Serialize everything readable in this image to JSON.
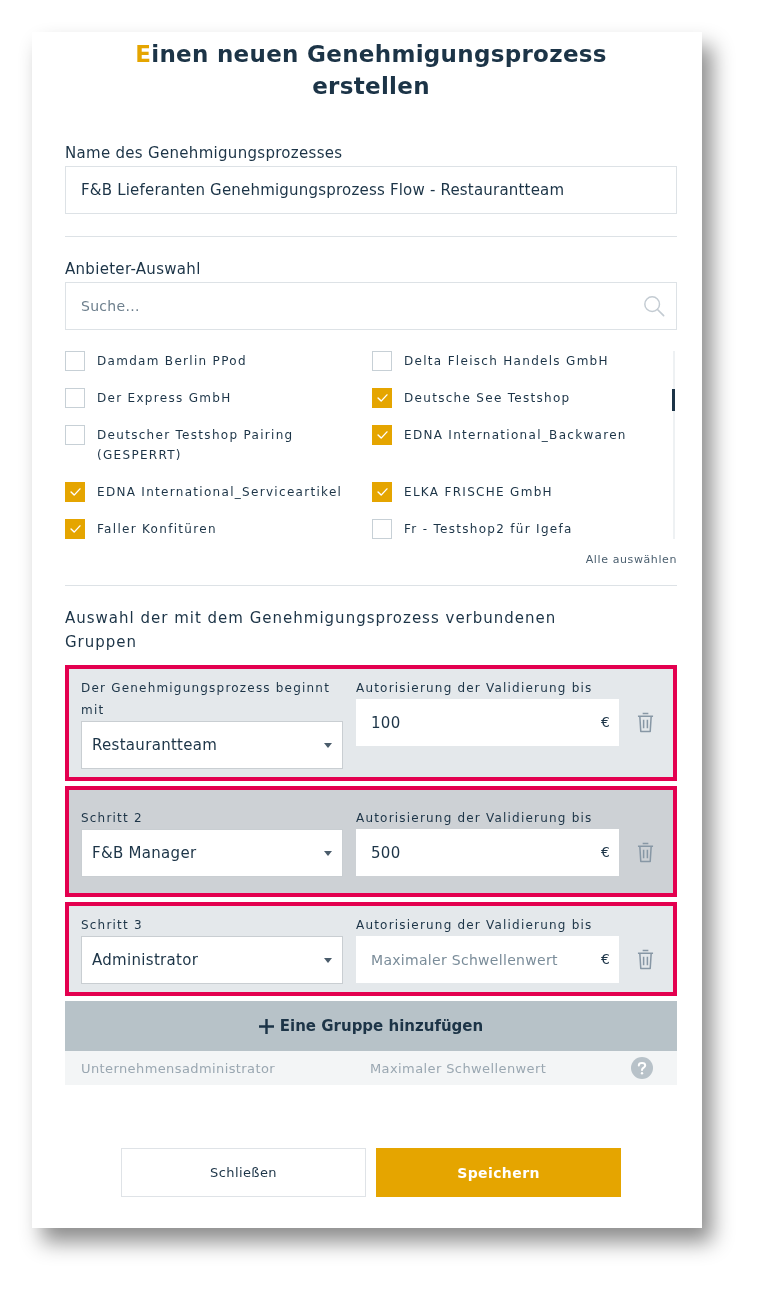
{
  "dialog": {
    "title": "Einen neuen Genehmigungsprozess erstellen"
  },
  "name_field": {
    "label": "Name des Genehmigungsprozesses",
    "value": "F&B Lieferanten Genehmigungsprozess Flow - Restaurantteam"
  },
  "vendor_selection": {
    "label": "Anbieter-Auswahl",
    "search": {
      "placeholder": "Suche..."
    },
    "vendors": [
      {
        "name": "Damdam Berlin PPod",
        "checked": false
      },
      {
        "name": "Delta Fleisch Handels GmbH",
        "checked": false
      },
      {
        "name": "Der Express GmbH",
        "checked": false
      },
      {
        "name": "Deutsche See Testshop",
        "checked": true
      },
      {
        "name": "Deutscher Testshop Pairing (GESPERRT)",
        "checked": false
      },
      {
        "name": "EDNA International_Backwaren",
        "checked": true
      },
      {
        "name": "EDNA International_Serviceartikel",
        "checked": true
      },
      {
        "name": "ELKA FRISCHE GmbH",
        "checked": true
      },
      {
        "name": "Faller Konfitüren",
        "checked": true
      },
      {
        "name": "Fr - Testshop2 für Igefa",
        "checked": false
      }
    ],
    "select_all": "Alle auswählen"
  },
  "groups": {
    "heading": "Auswahl der mit dem Genehmigungsprozess verbundenen Gruppen",
    "steps": [
      {
        "label": "Der Genehmigungsprozess beginnt mit",
        "group": "Restaurantteam",
        "threshold_label": "Autorisierung der Validierung bis",
        "threshold_value": "100",
        "currency": "€",
        "highlighted": true,
        "active": false
      },
      {
        "label": "Schritt 2",
        "group": "F&B Manager",
        "threshold_label": "Autorisierung der Validierung bis",
        "threshold_value": "500",
        "currency": "€",
        "highlighted": true,
        "active": true
      },
      {
        "label": "Schritt 3",
        "group": "Administrator",
        "threshold_label": "Autorisierung der Validierung bis",
        "threshold_placeholder": "Maximaler Schwellenwert",
        "currency": "€",
        "highlighted": true,
        "active": false
      }
    ],
    "add_button": "Eine Gruppe hinzufügen",
    "group_row": {
      "group": "Unternehmensadministrator",
      "threshold": "Maximaler Schwellenwert"
    }
  },
  "buttons": [
    {
      "label": "Schließen",
      "kind": "secondary"
    },
    {
      "label": "Speichern",
      "kind": "primary"
    }
  ]
}
